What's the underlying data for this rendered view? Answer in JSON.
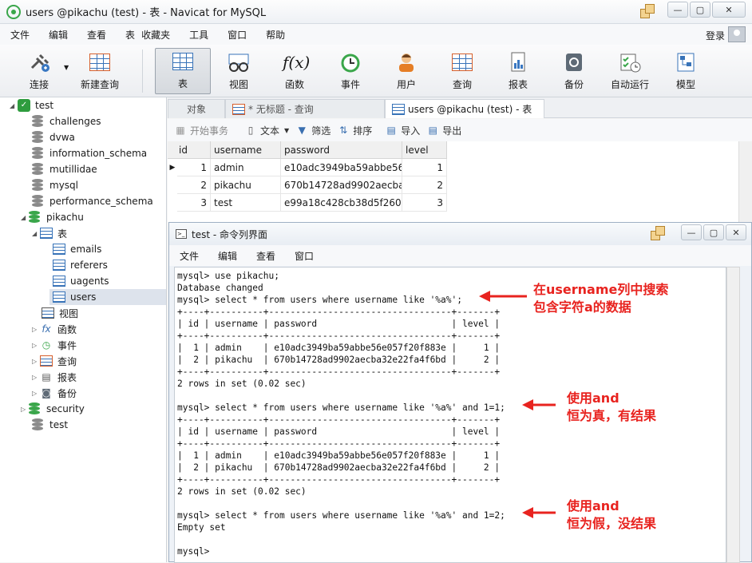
{
  "window": {
    "title": "users @pikachu (test) - 表 - Navicat for MySQL",
    "buttons": {
      "minimize": "—",
      "maximize": "▢",
      "close": "✕"
    }
  },
  "menubar": {
    "items": [
      "文件",
      "编辑",
      "查看",
      "表",
      "收藏夹",
      "工具",
      "窗口",
      "帮助"
    ],
    "login": "登录"
  },
  "toolbar": {
    "items": [
      {
        "label": "连接",
        "icon": "plug-connect-icon"
      },
      {
        "label": "新建查询",
        "icon": "new-query-icon"
      },
      {
        "label": "表",
        "icon": "table-icon"
      },
      {
        "label": "视图",
        "icon": "view-icon"
      },
      {
        "label": "函数",
        "icon": "function-icon"
      },
      {
        "label": "事件",
        "icon": "clock-event-icon"
      },
      {
        "label": "用户",
        "icon": "user-icon"
      },
      {
        "label": "查询",
        "icon": "query-icon"
      },
      {
        "label": "报表",
        "icon": "report-icon"
      },
      {
        "label": "备份",
        "icon": "backup-icon"
      },
      {
        "label": "自动运行",
        "icon": "schedule-icon"
      },
      {
        "label": "模型",
        "icon": "model-icon"
      }
    ]
  },
  "sidebar": {
    "connection": "test",
    "databases": [
      "challenges",
      "dvwa",
      "information_schema",
      "mutillidae",
      "mysql",
      "performance_schema"
    ],
    "open_db": "pikachu",
    "tables_group": "表",
    "tables": [
      "emails",
      "referers",
      "uagents",
      "users"
    ],
    "groups": [
      "视图",
      "函数",
      "事件",
      "查询",
      "报表",
      "备份"
    ],
    "more_dbs": [
      "security",
      "test"
    ]
  },
  "tabs": {
    "objects": "对象",
    "untitled_query": "* 无标题 - 查询",
    "users_table": "users @pikachu (test) - 表"
  },
  "subtoolbar": {
    "begin_transaction": "开始事务",
    "text": "文本",
    "filter": "筛选",
    "sort": "排序",
    "import": "导入",
    "export": "导出"
  },
  "grid": {
    "columns": [
      "id",
      "username",
      "password",
      "level"
    ],
    "rows": [
      [
        "1",
        "admin",
        "e10adc3949ba59abbe56e",
        "1"
      ],
      [
        "2",
        "pikachu",
        "670b14728ad9902aecba3",
        "2"
      ],
      [
        "3",
        "test",
        "e99a18c428cb38d5f2608!",
        "3"
      ]
    ]
  },
  "console_window": {
    "title": "test - 命令列界面",
    "menu": [
      "文件",
      "编辑",
      "查看",
      "窗口"
    ],
    "lines": [
      "mysql> use pikachu;",
      "Database changed",
      "mysql> select * from users where username like '%a%';",
      "+----+----------+----------------------------------+-------+",
      "| id | username | password                         | level |",
      "+----+----------+----------------------------------+-------+",
      "|  1 | admin    | e10adc3949ba59abbe56e057f20f883e |     1 |",
      "|  2 | pikachu  | 670b14728ad9902aecba32e22fa4f6bd |     2 |",
      "+----+----------+----------------------------------+-------+",
      "2 rows in set (0.02 sec)",
      "",
      "mysql> select * from users where username like '%a%' and 1=1;",
      "+----+----------+----------------------------------+-------+",
      "| id | username | password                         | level |",
      "+----+----------+----------------------------------+-------+",
      "|  1 | admin    | e10adc3949ba59abbe56e057f20f883e |     1 |",
      "|  2 | pikachu  | 670b14728ad9902aecba32e22fa4f6bd |     2 |",
      "+----+----------+----------------------------------+-------+",
      "2 rows in set (0.02 sec)",
      "",
      "mysql> select * from users where username like '%a%' and 1=2;",
      "Empty set",
      "",
      "mysql>"
    ]
  },
  "annotations": {
    "a1_line1": "在username列中搜索",
    "a1_line2": "包含字符a的数据",
    "a2_line1": "使用and",
    "a2_line2": "恒为真，有结果",
    "a3_line1": "使用and",
    "a3_line2": "恒为假，没结果",
    "color": "#e8231f"
  }
}
